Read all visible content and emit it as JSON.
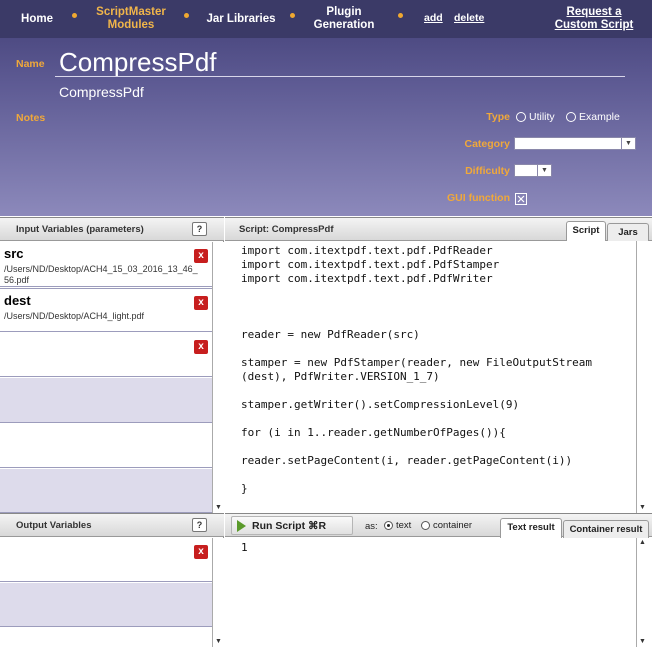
{
  "nav": {
    "home": "Home",
    "modules_line1": "ScriptMaster",
    "modules_line2": "Modules",
    "jar_libraries": "Jar Libraries",
    "plugin_line1": "Plugin",
    "plugin_line2": "Generation",
    "add": "add",
    "delete": "delete",
    "request_line1": "Request a",
    "request_line2": "Custom Script"
  },
  "header": {
    "name_label": "Name",
    "name_value": "CompressPdf",
    "subtitle": "CompressPdf",
    "notes_label": "Notes",
    "type_label": "Type",
    "type_options": [
      "Utility",
      "Example"
    ],
    "category_label": "Category",
    "category_value": "",
    "difficulty_label": "Difficulty",
    "difficulty_value": "",
    "gui_label": "GUI function",
    "gui_checked": true
  },
  "inputs": {
    "title": "Input Variables (parameters)",
    "help": "?",
    "remove_symbol": "x",
    "items": [
      {
        "name": "src",
        "path": "/Users/ND/Desktop/ACH4_15_03_2016_13_46_56.pdf"
      },
      {
        "name": "dest",
        "path": "/Users/ND/Desktop/ACH4_light.pdf"
      },
      {
        "name": "",
        "path": ""
      }
    ]
  },
  "outputs": {
    "title": "Output Variables",
    "help": "?"
  },
  "script": {
    "title": "Script: CompressPdf",
    "tabs": [
      "Script",
      "Jars"
    ],
    "active_tab": "Script",
    "code": "import com.itextpdf.text.pdf.PdfReader\nimport com.itextpdf.text.pdf.PdfStamper\nimport com.itextpdf.text.pdf.PdfWriter\n\n\n\nreader = new PdfReader(src)\n\nstamper = new PdfStamper(reader, new FileOutputStream\n(dest), PdfWriter.VERSION_1_7)\n\nstamper.getWriter().setCompressionLevel(9)\n\nfor (i in 1..reader.getNumberOfPages()){\n\nreader.setPageContent(i, reader.getPageContent(i))\n\n}"
  },
  "run": {
    "button": "Run Script ⌘R",
    "as_label": "as:",
    "text_option": "text",
    "container_option": "container",
    "selected": "text",
    "result_tabs": [
      "Text result",
      "Container result"
    ],
    "active_result_tab": "Text result",
    "result": "1"
  },
  "colors": {
    "nav_bg": "#3b3a67",
    "accent_orange": "#f0a83a",
    "remove_red": "#c71e1e",
    "empty_slot": "#dddbeb"
  }
}
